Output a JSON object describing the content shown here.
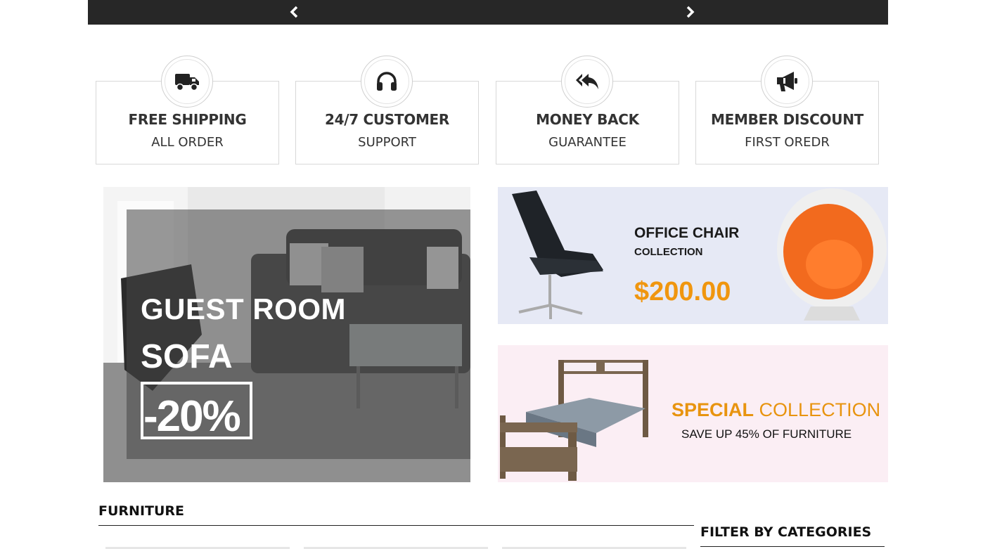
{
  "slider": {
    "prev_icon": "chevron-left-icon",
    "next_icon": "chevron-right-icon"
  },
  "features": [
    {
      "title": "FREE SHIPPING",
      "subtitle": "ALL ORDER",
      "icon": "truck-icon"
    },
    {
      "title": "24/7 CUSTOMER",
      "subtitle": "SUPPORT",
      "icon": "headphones-icon"
    },
    {
      "title": "MONEY BACK",
      "subtitle": "GUARANTEE",
      "icon": "reply-all-icon"
    },
    {
      "title": "MEMBER DISCOUNT",
      "subtitle": "FIRST OREDR",
      "icon": "bullhorn-icon"
    }
  ],
  "banners": {
    "guest_room": {
      "line1": "GUEST ROOM",
      "line2": "SOFA",
      "discount": "-20%"
    },
    "office_chair": {
      "title": "OFFICE CHAIR",
      "subtitle": "COLLECTION",
      "price": "$200.00"
    },
    "special": {
      "title_bold": "SPECIAL",
      "title_rest": " COLLECTION",
      "subtitle": "SAVE UP 45% OF FURNITURE"
    }
  },
  "sections": {
    "furniture_title": "FURNITURE",
    "filter_title": "FILTER BY CATEGORIES"
  },
  "colors": {
    "dark_bar": "#272727",
    "price_orange": "#f0960f",
    "special_orange": "#e8940f",
    "office_bg": "#e6e9f5",
    "special_bg": "#fbeef4"
  }
}
